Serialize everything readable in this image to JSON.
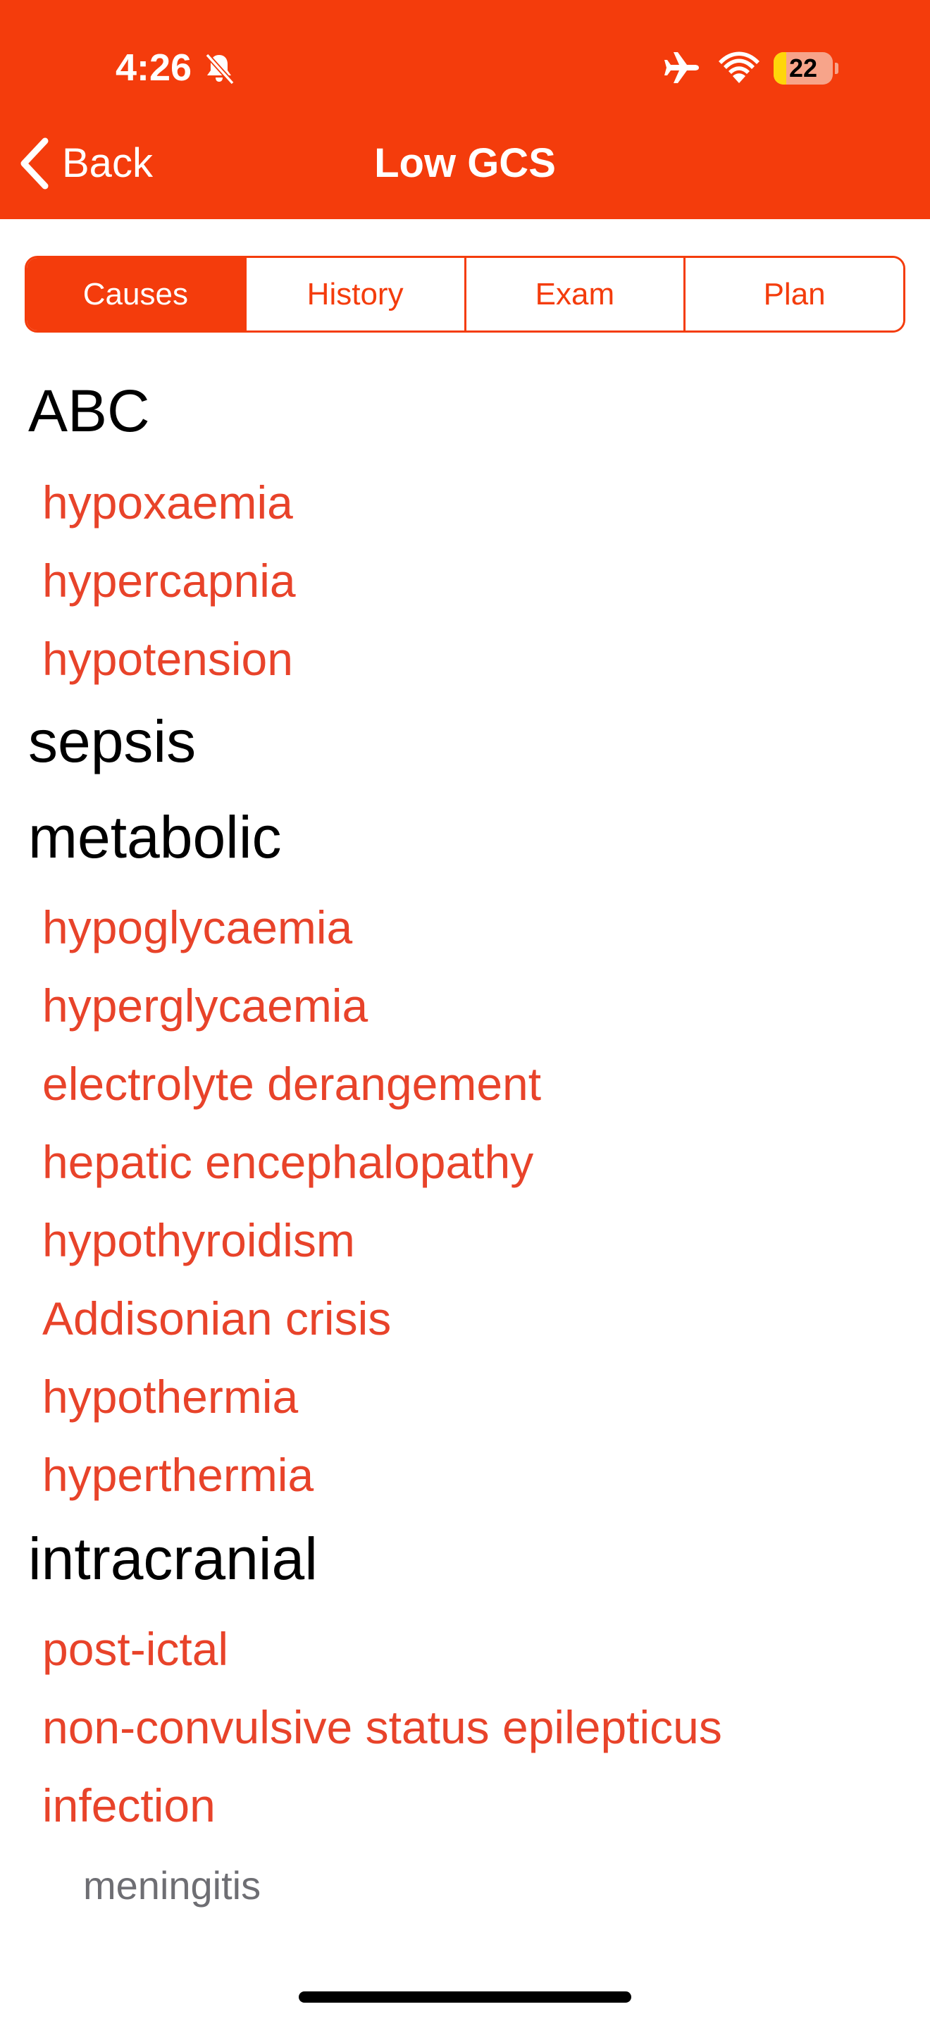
{
  "status_bar": {
    "time": "4:26",
    "battery_level": "22",
    "battery_fraction": 0.22,
    "colors": {
      "battery_fill": "#ffd60a",
      "battery_body": "#f7a48a"
    },
    "icons": [
      "bell-slash-icon",
      "airplane-icon",
      "wifi-icon",
      "battery-icon"
    ]
  },
  "nav": {
    "back_label": "Back",
    "title": "Low GCS",
    "background": "#f43c0c"
  },
  "tabs": [
    {
      "label": "Causes",
      "selected": true
    },
    {
      "label": "History",
      "selected": false
    },
    {
      "label": "Exam",
      "selected": false
    },
    {
      "label": "Plan",
      "selected": false
    }
  ],
  "sections": [
    {
      "heading": "ABC",
      "items": [
        "hypoxaemia",
        "hypercapnia",
        "hypotension"
      ]
    },
    {
      "heading": "sepsis",
      "items": []
    },
    {
      "heading": "metabolic",
      "items": [
        "hypoglycaemia",
        "hyperglycaemia",
        "electrolyte derangement",
        "hepatic encephalopathy",
        "hypothyroidism",
        "Addisonian crisis",
        "hypothermia",
        "hyperthermia"
      ]
    },
    {
      "heading": "intracranial",
      "items": [
        "post-ictal",
        "non-convulsive status epilepticus",
        "infection"
      ],
      "subitems": [
        "meningitis"
      ]
    }
  ],
  "colors": {
    "accent": "#f43c0c",
    "link_text": "#e8432a",
    "heading_text": "#000000",
    "subitem_text": "#6e6e73"
  }
}
